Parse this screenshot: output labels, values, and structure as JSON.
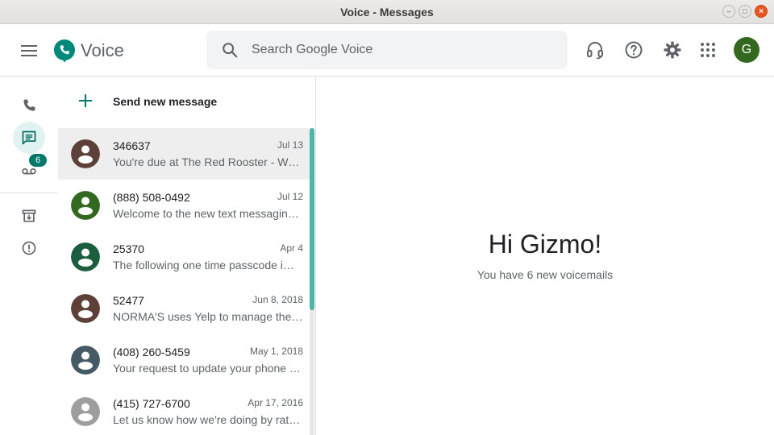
{
  "window": {
    "title": "Voice - Messages"
  },
  "header": {
    "app_name": "Voice",
    "search_placeholder": "Search Google Voice",
    "user_initial": "G"
  },
  "rail": {
    "voicemail_badge": "6"
  },
  "list": {
    "send_new_label": "Send new message",
    "conversations": [
      {
        "name": "346637",
        "date": "Jul 13",
        "snippet": "You're due at The Red Rooster - Wo…",
        "avatar_color": "#5d4037"
      },
      {
        "name": "(888) 508-0492",
        "date": "Jul 12",
        "snippet": "Welcome to the new text messagin…",
        "avatar_color": "#33691e"
      },
      {
        "name": "25370",
        "date": "Apr 4",
        "snippet": "The following one time passcode i…",
        "avatar_color": "#1b5e3f"
      },
      {
        "name": "52477",
        "date": "Jun 8, 2018",
        "snippet": "NORMA'S uses Yelp to manage thei…",
        "avatar_color": "#5d4037"
      },
      {
        "name": "(408) 260-5459",
        "date": "May 1, 2018",
        "snippet": "Your request to update your phone …",
        "avatar_color": "#455a64"
      },
      {
        "name": "(415) 727-6700",
        "date": "Apr 17, 2016",
        "snippet": "Let us know how we're doing by rat…",
        "avatar_color": "#9e9e9e"
      }
    ]
  },
  "main": {
    "greeting": "Hi Gizmo!",
    "subtext": "You have 6 new voicemails"
  },
  "colors": {
    "accent": "#00796b",
    "scroll_thumb": "#4db6ac",
    "active_rail_bg": "#e0f2f1"
  }
}
